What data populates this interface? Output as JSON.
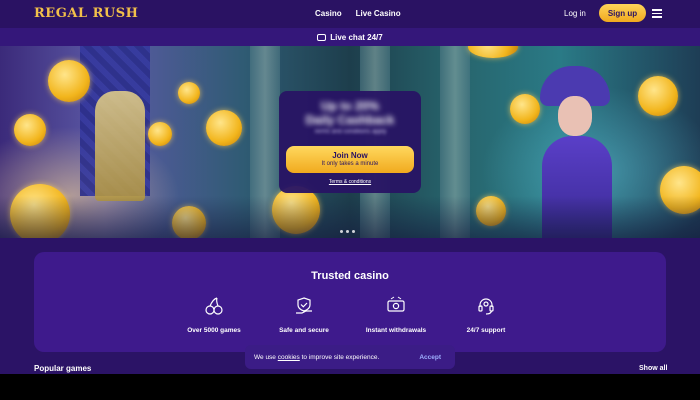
{
  "header": {
    "logo": "REGAL RUSH",
    "nav": [
      "Casino",
      "Live Casino"
    ],
    "login_label": "Log in",
    "signup_label": "Sign up"
  },
  "live_chat": {
    "label": "Live chat 24/7"
  },
  "promo": {
    "title_line1": "Up to 20%",
    "title_line2": "Daily Cashback",
    "subtitle": "Terms and conditions apply",
    "join_label": "Join Now",
    "join_sublabel": "It only takes a minute",
    "terms_label": "Terms & conditions"
  },
  "trusted": {
    "title": "Trusted casino",
    "features": [
      {
        "label": "Over 5000 games",
        "icon": "cherries-icon"
      },
      {
        "label": "Safe and secure",
        "icon": "shield-hand-icon"
      },
      {
        "label": "Instant withdrawals",
        "icon": "money-icon"
      },
      {
        "label": "24/7 support",
        "icon": "headset-icon"
      }
    ]
  },
  "popular_games": {
    "title": "Popular games",
    "show_all_label": "Show all"
  },
  "cookie": {
    "text_before": "We use",
    "link": "cookies",
    "text_after": "to improve site experience.",
    "accept_label": "Accept"
  },
  "colors": {
    "brand_gold": "#f2c04a",
    "background": "#2b1366",
    "card": "#3e1a8c",
    "button": "#f1aa1e"
  }
}
